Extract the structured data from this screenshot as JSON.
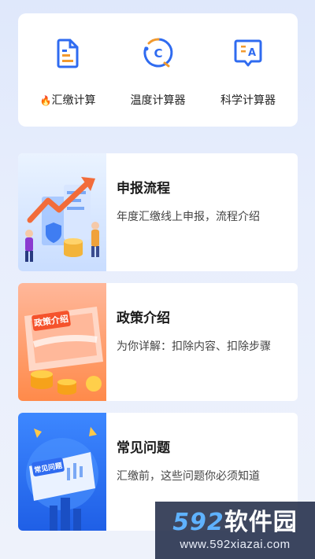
{
  "tools": [
    {
      "icon": "document-icon",
      "prefix": "🔥",
      "label": "汇缴计算"
    },
    {
      "icon": "thermometer-c-icon",
      "prefix": "",
      "label": "温度计算器"
    },
    {
      "icon": "calculator-a-icon",
      "prefix": "",
      "label": "科学计算器"
    }
  ],
  "features": [
    {
      "title": "申报流程",
      "desc": "年度汇缴线上申报，流程介绍",
      "thumb": "growth-chart-illustration"
    },
    {
      "title": "政策介绍",
      "desc": "为你详解：扣除内容、扣除步骤",
      "thumb": "policy-card-illustration",
      "thumb_text": "政策介绍"
    },
    {
      "title": "常见问题",
      "desc": "汇缴前，这些问题你必须知道",
      "thumb": "faq-card-illustration",
      "thumb_text": "常见问题"
    }
  ],
  "watermark": {
    "brand_num": "592",
    "brand_text": "软件园",
    "url": "www.592xiazai.com"
  },
  "colors": {
    "accent": "#2f6bf0",
    "orange": "#f29a2e",
    "background": "#e6edfb"
  }
}
